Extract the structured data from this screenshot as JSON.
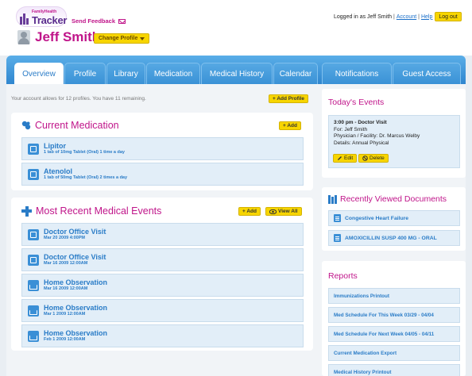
{
  "header": {
    "logo_small": "FamilyHealth",
    "logo_big": "Tracker",
    "feedback_label": "Send Feedback",
    "user_name": "Jeff Smith",
    "change_profile_label": "Change Profile",
    "logged_in_text": "Logged in as Jeff Smith",
    "account_link": "Account",
    "help_link": "Help",
    "logout_label": "Log out"
  },
  "tabs": [
    {
      "label": "Overview",
      "active": true
    },
    {
      "label": "Profile",
      "active": false
    },
    {
      "label": "Library",
      "active": false
    },
    {
      "label": "Medication",
      "active": false
    },
    {
      "label": "Medical History",
      "active": false
    },
    {
      "label": "Calendar",
      "active": false
    },
    {
      "label": "Notifications",
      "active": false
    },
    {
      "label": "Guest Access",
      "active": false
    }
  ],
  "account_note": "Your account allows for 12 profiles. You have 11 remaining.",
  "add_profile_label": "+ Add Profile",
  "current_medication": {
    "title": "Current Medication",
    "add_label": "+ Add",
    "items": [
      {
        "name": "Lipitor",
        "detail": "1 tab of 10mg Tablet (Oral) 1 time a day"
      },
      {
        "name": "Atenolol",
        "detail": "1 tab of 50mg Tablet (Oral) 2 times a day"
      }
    ]
  },
  "medical_events": {
    "title": "Most Recent Medical Events",
    "add_label": "+ Add",
    "view_all_label": "View All",
    "items": [
      {
        "name": "Doctor Office Visit",
        "date": "Mar 20 2009 4:00PM",
        "icon": "doctor-icon"
      },
      {
        "name": "Doctor Office Visit",
        "date": "Mar 16 2009 12:00AM",
        "icon": "doctor-icon"
      },
      {
        "name": "Home Observation",
        "date": "Mar 16 2009 12:00AM",
        "icon": "house-icon"
      },
      {
        "name": "Home Observation",
        "date": "Mar 1 2009 12:00AM",
        "icon": "house-icon"
      },
      {
        "name": "Home Observation",
        "date": "Feb 1 2009 12:00AM",
        "icon": "house-icon"
      }
    ]
  },
  "todays_events": {
    "title": "Today's Events",
    "event_time": "3:00 pm - Doctor Visit",
    "event_for": "For: Jeff Smith",
    "event_physician": "Physician / Facility: Dr. Marcus Welby",
    "event_details": "Details: Annual Physical",
    "edit_label": "Edit",
    "delete_label": "Delete"
  },
  "recent_documents": {
    "title": "Recently Viewed Documents",
    "items": [
      "Congestive Heart Failure",
      "AMOXICILLIN SUSP 400 MG - ORAL"
    ]
  },
  "reports": {
    "title": "Reports",
    "items": [
      "Immunizations Printout",
      "Med Schedule For This Week 03/29 - 04/04",
      "Med Schedule For Next Week 04/05 - 04/11",
      "Current Medication Export",
      "Medical History Printout"
    ]
  },
  "colors": {
    "accent_blue": "#2f86cf",
    "brand_magenta": "#c0158a",
    "button_yellow": "#f7d500"
  }
}
